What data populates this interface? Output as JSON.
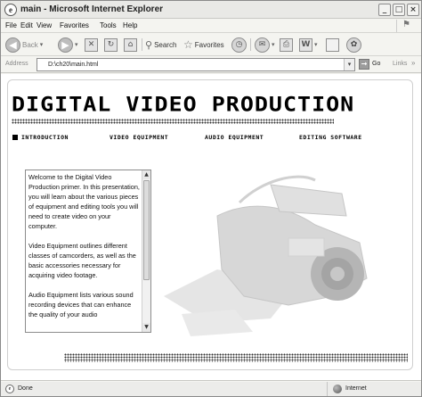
{
  "window": {
    "title": "main - Microsoft Internet Explorer"
  },
  "menu": [
    "File",
    "Edit",
    "View",
    "Favorites",
    "Tools",
    "Help"
  ],
  "toolbar": {
    "back_label": "Back",
    "search_label": "Search",
    "favorites_label": "Favorites"
  },
  "address": {
    "label": "Address",
    "value": "D:\\ch20\\main.html",
    "go_label": "Go",
    "links_label": "Links"
  },
  "page": {
    "title": "DIGITAL VIDEO PRODUCTION",
    "nav": [
      "INTRODUCTION",
      "VIDEO EQUIPMENT",
      "AUDIO EQUIPMENT",
      "EDITING SOFTWARE"
    ],
    "paragraphs": [
      "Welcome to the Digital Video Production primer. In this presentation, you will learn about the various pieces of equipment and editing tools you will need to create video on your computer.",
      "Video Equipment outlines different classes of camcorders, as well as the basic accessories necessary for acquiring video footage.",
      "Audio Equipment lists various sound recording devices that can enhance the quality of your audio"
    ]
  },
  "status": {
    "text": "Done",
    "zone": "Internet"
  }
}
